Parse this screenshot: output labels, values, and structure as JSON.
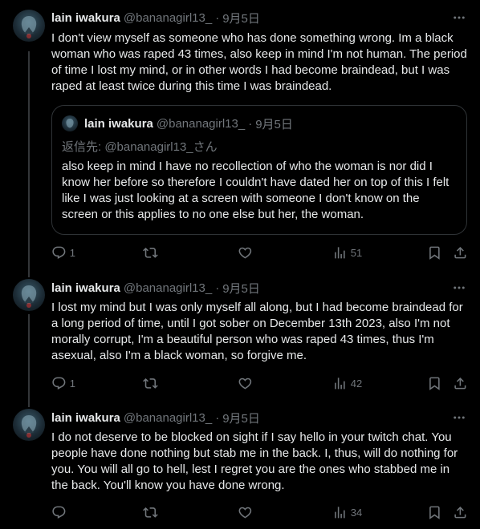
{
  "tweets": [
    {
      "name": "lain iwakura",
      "handle": "@bananagirl13_",
      "sep": "·",
      "date": "9月5日",
      "text": "I don't view myself as someone who has done something wrong. Im a black woman who was raped 43 times, also keep in mind I'm not human. The period of time I lost my mind, or in other words I had become braindead, but I was raped at least twice during this time I was braindead.",
      "quote": {
        "name": "lain iwakura",
        "handle": "@bananagirl13_",
        "sep": "·",
        "date": "9月5日",
        "reply_to": "返信先: @bananagirl13_さん",
        "text": "also keep in mind I have no recollection of who the woman is nor did I know her before so therefore I couldn't have dated her on top of this I felt like I was just looking at a screen with someone I don't know on the screen or this applies to no one else but her, the woman."
      },
      "replies": "1",
      "views": "51"
    },
    {
      "name": "lain iwakura",
      "handle": "@bananagirl13_",
      "sep": "·",
      "date": "9月5日",
      "text": "I lost my mind but I was only myself all along, but I had become braindead for a long period of time, until I got sober on December 13th 2023, also I'm not morally corrupt, I'm a beautiful person who was raped 43 times, thus I'm asexual, also I'm a black woman, so forgive me.",
      "replies": "1",
      "views": "42"
    },
    {
      "name": "lain iwakura",
      "handle": "@bananagirl13_",
      "sep": "·",
      "date": "9月5日",
      "text": "I do not deserve to be blocked on sight if I say hello in your twitch chat. You people have done nothing but stab me in the back. I, thus, will do nothing for you. You will all go to hell, lest I regret you are the ones who stabbed me in the back. You'll know you have done wrong.",
      "replies": "",
      "views": "34"
    }
  ],
  "icons": {
    "reply": "reply-icon",
    "retweet": "retweet-icon",
    "like": "like-icon",
    "views": "views-icon",
    "bookmark": "bookmark-icon",
    "share": "share-icon",
    "more": "more-icon"
  },
  "colors": {
    "background": "#000000",
    "text": "#e7e9ea",
    "secondary": "#71767b",
    "border": "#2f3336"
  }
}
